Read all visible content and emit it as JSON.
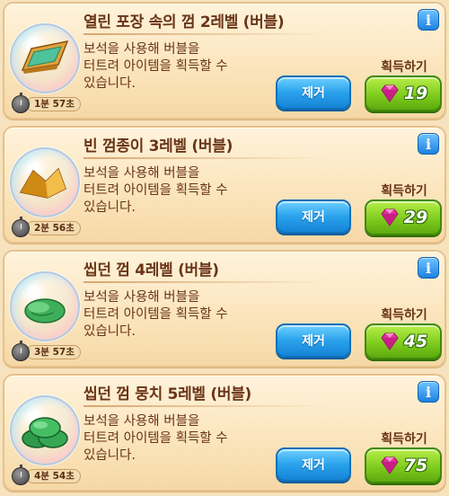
{
  "items": [
    {
      "title": "열린 포장 속의 껌 2레벨 (버블)",
      "description": "보석을 사용해 버블을\n터트려 아이템을 획득할 수\n있습니다.",
      "timer": "1분 57초",
      "remove_label": "제거",
      "get_label": "획득하기",
      "price": "19",
      "item_icon": "open-wrapper-gum-icon"
    },
    {
      "title": "빈 껌종이 3레벨 (버블)",
      "description": "보석을 사용해 버블을\n터트려 아이템을 획득할 수\n있습니다.",
      "timer": "2분 56초",
      "remove_label": "제거",
      "get_label": "획득하기",
      "price": "29",
      "item_icon": "empty-gum-wrapper-icon"
    },
    {
      "title": "씹던 껌 4레벨 (버블)",
      "description": "보석을 사용해 버블을\n터트려 아이템을 획득할 수\n있습니다.",
      "timer": "3분 57초",
      "remove_label": "제거",
      "get_label": "획득하기",
      "price": "45",
      "item_icon": "chewed-gum-icon"
    },
    {
      "title": "씹던 껌 뭉치 5레벨 (버블)",
      "description": "보석을 사용해 버블을\n터트려 아이템을 획득할 수\n있습니다.",
      "timer": "4분 54초",
      "remove_label": "제거",
      "get_label": "획득하기",
      "price": "75",
      "item_icon": "chewed-gum-lump-icon"
    }
  ],
  "colors": {
    "remove_button": "#2aa2ec",
    "buy_button": "#7fcc1e",
    "gem": "#e0309a",
    "card_bg": "#fbe5bd"
  }
}
